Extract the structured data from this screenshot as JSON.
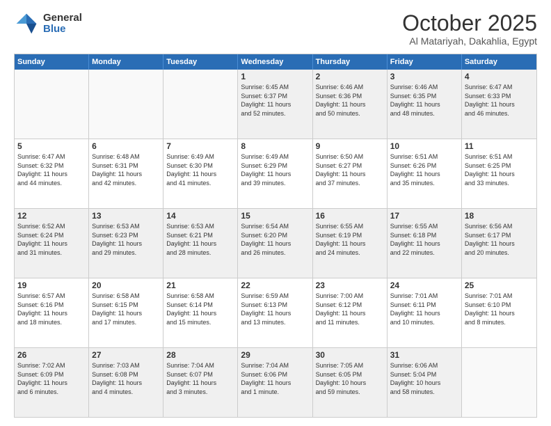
{
  "logo": {
    "general": "General",
    "blue": "Blue"
  },
  "title": "October 2025",
  "location": "Al Matariyah, Dakahlia, Egypt",
  "days_of_week": [
    "Sunday",
    "Monday",
    "Tuesday",
    "Wednesday",
    "Thursday",
    "Friday",
    "Saturday"
  ],
  "weeks": [
    [
      {
        "day": "",
        "info": ""
      },
      {
        "day": "",
        "info": ""
      },
      {
        "day": "",
        "info": ""
      },
      {
        "day": "1",
        "info": "Sunrise: 6:45 AM\nSunset: 6:37 PM\nDaylight: 11 hours\nand 52 minutes."
      },
      {
        "day": "2",
        "info": "Sunrise: 6:46 AM\nSunset: 6:36 PM\nDaylight: 11 hours\nand 50 minutes."
      },
      {
        "day": "3",
        "info": "Sunrise: 6:46 AM\nSunset: 6:35 PM\nDaylight: 11 hours\nand 48 minutes."
      },
      {
        "day": "4",
        "info": "Sunrise: 6:47 AM\nSunset: 6:33 PM\nDaylight: 11 hours\nand 46 minutes."
      }
    ],
    [
      {
        "day": "5",
        "info": "Sunrise: 6:47 AM\nSunset: 6:32 PM\nDaylight: 11 hours\nand 44 minutes."
      },
      {
        "day": "6",
        "info": "Sunrise: 6:48 AM\nSunset: 6:31 PM\nDaylight: 11 hours\nand 42 minutes."
      },
      {
        "day": "7",
        "info": "Sunrise: 6:49 AM\nSunset: 6:30 PM\nDaylight: 11 hours\nand 41 minutes."
      },
      {
        "day": "8",
        "info": "Sunrise: 6:49 AM\nSunset: 6:29 PM\nDaylight: 11 hours\nand 39 minutes."
      },
      {
        "day": "9",
        "info": "Sunrise: 6:50 AM\nSunset: 6:27 PM\nDaylight: 11 hours\nand 37 minutes."
      },
      {
        "day": "10",
        "info": "Sunrise: 6:51 AM\nSunset: 6:26 PM\nDaylight: 11 hours\nand 35 minutes."
      },
      {
        "day": "11",
        "info": "Sunrise: 6:51 AM\nSunset: 6:25 PM\nDaylight: 11 hours\nand 33 minutes."
      }
    ],
    [
      {
        "day": "12",
        "info": "Sunrise: 6:52 AM\nSunset: 6:24 PM\nDaylight: 11 hours\nand 31 minutes."
      },
      {
        "day": "13",
        "info": "Sunrise: 6:53 AM\nSunset: 6:23 PM\nDaylight: 11 hours\nand 29 minutes."
      },
      {
        "day": "14",
        "info": "Sunrise: 6:53 AM\nSunset: 6:21 PM\nDaylight: 11 hours\nand 28 minutes."
      },
      {
        "day": "15",
        "info": "Sunrise: 6:54 AM\nSunset: 6:20 PM\nDaylight: 11 hours\nand 26 minutes."
      },
      {
        "day": "16",
        "info": "Sunrise: 6:55 AM\nSunset: 6:19 PM\nDaylight: 11 hours\nand 24 minutes."
      },
      {
        "day": "17",
        "info": "Sunrise: 6:55 AM\nSunset: 6:18 PM\nDaylight: 11 hours\nand 22 minutes."
      },
      {
        "day": "18",
        "info": "Sunrise: 6:56 AM\nSunset: 6:17 PM\nDaylight: 11 hours\nand 20 minutes."
      }
    ],
    [
      {
        "day": "19",
        "info": "Sunrise: 6:57 AM\nSunset: 6:16 PM\nDaylight: 11 hours\nand 18 minutes."
      },
      {
        "day": "20",
        "info": "Sunrise: 6:58 AM\nSunset: 6:15 PM\nDaylight: 11 hours\nand 17 minutes."
      },
      {
        "day": "21",
        "info": "Sunrise: 6:58 AM\nSunset: 6:14 PM\nDaylight: 11 hours\nand 15 minutes."
      },
      {
        "day": "22",
        "info": "Sunrise: 6:59 AM\nSunset: 6:13 PM\nDaylight: 11 hours\nand 13 minutes."
      },
      {
        "day": "23",
        "info": "Sunrise: 7:00 AM\nSunset: 6:12 PM\nDaylight: 11 hours\nand 11 minutes."
      },
      {
        "day": "24",
        "info": "Sunrise: 7:01 AM\nSunset: 6:11 PM\nDaylight: 11 hours\nand 10 minutes."
      },
      {
        "day": "25",
        "info": "Sunrise: 7:01 AM\nSunset: 6:10 PM\nDaylight: 11 hours\nand 8 minutes."
      }
    ],
    [
      {
        "day": "26",
        "info": "Sunrise: 7:02 AM\nSunset: 6:09 PM\nDaylight: 11 hours\nand 6 minutes."
      },
      {
        "day": "27",
        "info": "Sunrise: 7:03 AM\nSunset: 6:08 PM\nDaylight: 11 hours\nand 4 minutes."
      },
      {
        "day": "28",
        "info": "Sunrise: 7:04 AM\nSunset: 6:07 PM\nDaylight: 11 hours\nand 3 minutes."
      },
      {
        "day": "29",
        "info": "Sunrise: 7:04 AM\nSunset: 6:06 PM\nDaylight: 11 hours\nand 1 minute."
      },
      {
        "day": "30",
        "info": "Sunrise: 7:05 AM\nSunset: 6:05 PM\nDaylight: 10 hours\nand 59 minutes."
      },
      {
        "day": "31",
        "info": "Sunrise: 6:06 AM\nSunset: 5:04 PM\nDaylight: 10 hours\nand 58 minutes."
      },
      {
        "day": "",
        "info": ""
      }
    ]
  ]
}
